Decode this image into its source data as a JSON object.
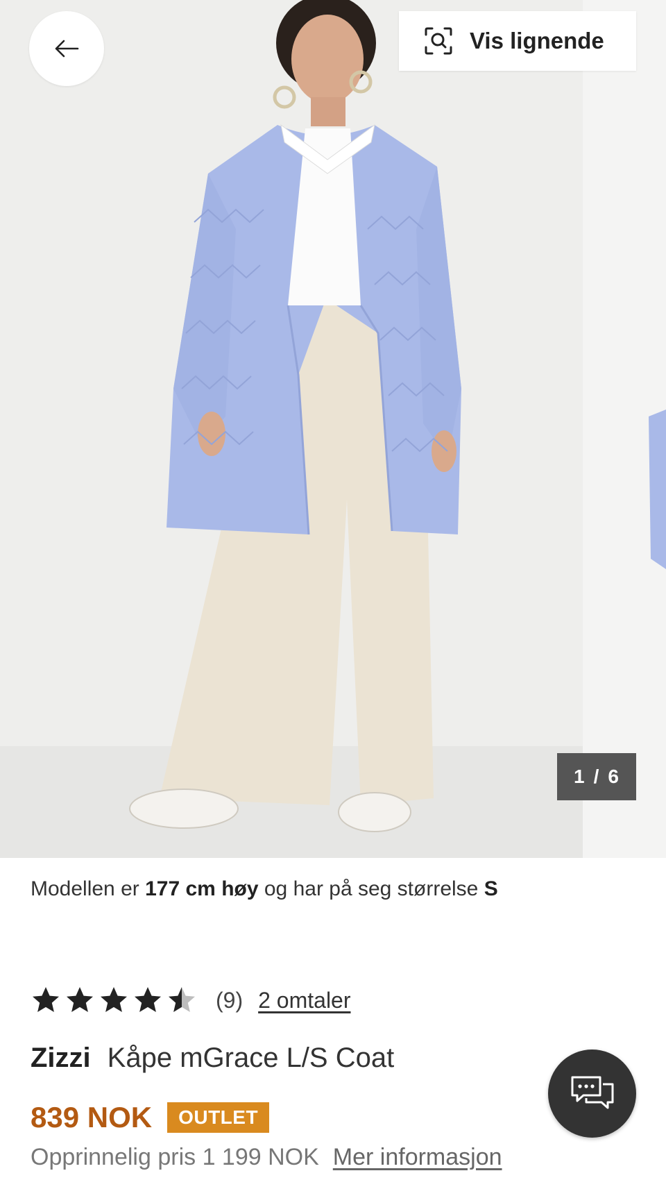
{
  "gallery": {
    "similar_label": "Vis lignende",
    "current_page": "1",
    "separator": "/",
    "total_pages": "6"
  },
  "model_info": {
    "prefix": "Modellen er",
    "height": "177 cm høy",
    "middle": "og har på seg størrelse",
    "size": "S"
  },
  "rating": {
    "stars_value": 4.5,
    "stars_max": 5,
    "count": "(9)",
    "reviews_link": "2 omtaler"
  },
  "product": {
    "brand": "Zizzi",
    "name": "Kåpe mGrace L/S Coat",
    "price": "839 NOK",
    "badge": "OUTLET",
    "original_price": "Opprinnelig pris 1 199 NOK",
    "more_info_link": "Mer informasjon"
  },
  "colors": {
    "price": "#b35a12",
    "badge": "#d98a1f",
    "coat": "#a9b9e8",
    "trousers": "#ebe3d3",
    "chat": "#333333"
  },
  "icons": {
    "back": "arrow-left-icon",
    "similar": "visual-search-icon",
    "star": "star-icon",
    "chat": "chat-bubbles-icon"
  }
}
